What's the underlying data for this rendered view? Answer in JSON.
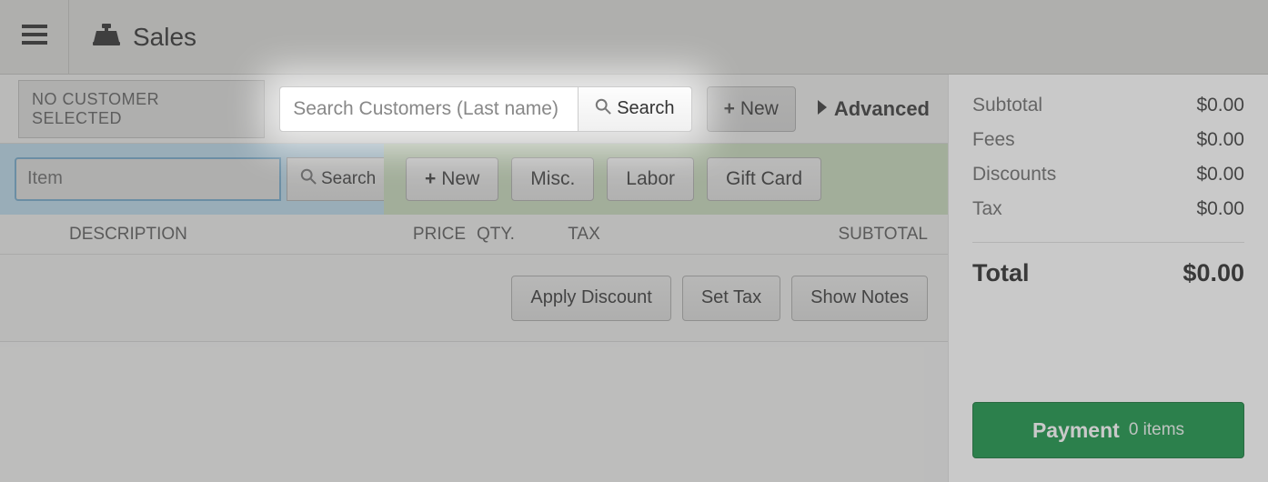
{
  "header": {
    "title": "Sales"
  },
  "customer_bar": {
    "no_customer_label": "NO CUSTOMER SELECTED",
    "search_placeholder": "Search Customers (Last name)",
    "search_btn": "Search",
    "new_btn": "New",
    "advanced_label": "Advanced"
  },
  "item_bar": {
    "item_placeholder": "Item",
    "search_btn": "Search",
    "new_btn": "New",
    "misc_btn": "Misc.",
    "labor_btn": "Labor",
    "giftcard_btn": "Gift Card"
  },
  "table": {
    "columns": {
      "description": "DESCRIPTION",
      "price": "PRICE",
      "qty": "QTY.",
      "tax": "TAX",
      "subtotal": "SUBTOTAL"
    }
  },
  "row_actions": {
    "apply_discount": "Apply Discount",
    "set_tax": "Set Tax",
    "show_notes": "Show Notes"
  },
  "totals": {
    "subtotal_label": "Subtotal",
    "subtotal_value": "$0.00",
    "fees_label": "Fees",
    "fees_value": "$0.00",
    "discounts_label": "Discounts",
    "discounts_value": "$0.00",
    "tax_label": "Tax",
    "tax_value": "$0.00",
    "total_label": "Total",
    "total_value": "$0.00"
  },
  "payment": {
    "label": "Payment",
    "items_text": "0 items"
  }
}
